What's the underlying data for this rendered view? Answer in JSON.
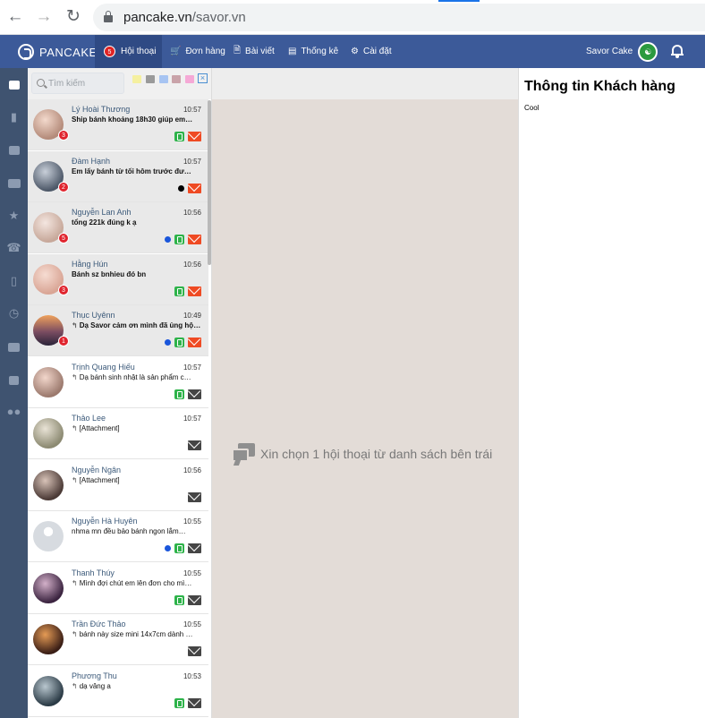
{
  "browser": {
    "url_host": "pancake.vn",
    "url_path": "/savor.vn"
  },
  "header": {
    "logo_text": "PANCAKE",
    "nav": [
      {
        "label": "Hội thoại",
        "badge": "5"
      },
      {
        "label": "Đơn hàng"
      },
      {
        "label": "Bài viết"
      },
      {
        "label": "Thống kê"
      },
      {
        "label": "Cài đặt"
      }
    ],
    "shop_name": "Savor Cake"
  },
  "search": {
    "placeholder": "Tìm kiếm"
  },
  "tag_colors": [
    "#f5f0a0",
    "#9a9a9a",
    "#a7c4f2",
    "#c9a3a9",
    "#f5a9d6"
  ],
  "conversations": [
    {
      "name": "Lý Hoài Thương",
      "time": "10:57",
      "snippet": "Ship bánh khoảng 18h30 giúp em…",
      "unread": "3",
      "reply": false,
      "dot": "",
      "phone": true,
      "mail": "red"
    },
    {
      "name": "Đàm Hạnh",
      "time": "10:57",
      "snippet": "Em lấy bánh từ tối hôm trước đư…",
      "unread": "2",
      "reply": false,
      "dot": "#000000",
      "phone": false,
      "mail": "red"
    },
    {
      "name": "Nguyễn Lan Anh",
      "time": "10:56",
      "snippet": "tổng 221k đúng k ạ",
      "unread": "5",
      "reply": false,
      "dot": "#1a56db",
      "phone": true,
      "mail": "red"
    },
    {
      "name": "Hằng Hún",
      "time": "10:56",
      "snippet": "Bánh sz bnhieu đó bn",
      "unread": "3",
      "reply": false,
      "dot": "",
      "phone": true,
      "mail": "red"
    },
    {
      "name": "Thục Uyênn",
      "time": "10:49",
      "snippet": "Dạ Savor cảm ơn mình đã ủng hộ…",
      "unread": "1",
      "reply": true,
      "dot": "#1a56db",
      "phone": true,
      "mail": "red"
    },
    {
      "name": "Trịnh Quang Hiếu",
      "time": "10:57",
      "snippet": "Dạ bánh sinh nhật là sản phẩm c…",
      "unread": "",
      "reply": true,
      "dot": "",
      "phone": true,
      "mail": "grey"
    },
    {
      "name": "Thảo Lee",
      "time": "10:57",
      "snippet": "[Attachment]",
      "unread": "",
      "reply": true,
      "dot": "",
      "phone": false,
      "mail": "grey"
    },
    {
      "name": "Nguyễn Ngân",
      "time": "10:56",
      "snippet": "[Attachment]",
      "unread": "",
      "reply": true,
      "dot": "",
      "phone": false,
      "mail": "grey"
    },
    {
      "name": "Nguyễn Hà Huyên",
      "time": "10:55",
      "snippet": "nhma mn đều bảo bánh ngon lắm…",
      "unread": "",
      "reply": false,
      "dot": "#1a56db",
      "phone": true,
      "mail": "grey"
    },
    {
      "name": "Thanh Thúy",
      "time": "10:55",
      "snippet": "Mình đợi chút em lên đơn cho mì…",
      "unread": "",
      "reply": true,
      "dot": "",
      "phone": true,
      "mail": "grey"
    },
    {
      "name": "Trần Đức Thảo",
      "time": "10:55",
      "snippet": "bánh này size mini 14x7cm dành …",
      "unread": "",
      "reply": true,
      "dot": "",
      "phone": false,
      "mail": "grey"
    },
    {
      "name": "Phương Thu",
      "time": "10:53",
      "snippet": "dạ vâng a",
      "unread": "",
      "reply": true,
      "dot": "",
      "phone": true,
      "mail": "grey"
    }
  ],
  "middle": {
    "empty_text": "Xin chọn 1 hội thoại từ danh sách bên trái"
  },
  "right_panel": {
    "title": "Thông tin Khách hàng",
    "subtitle": "Cool"
  }
}
